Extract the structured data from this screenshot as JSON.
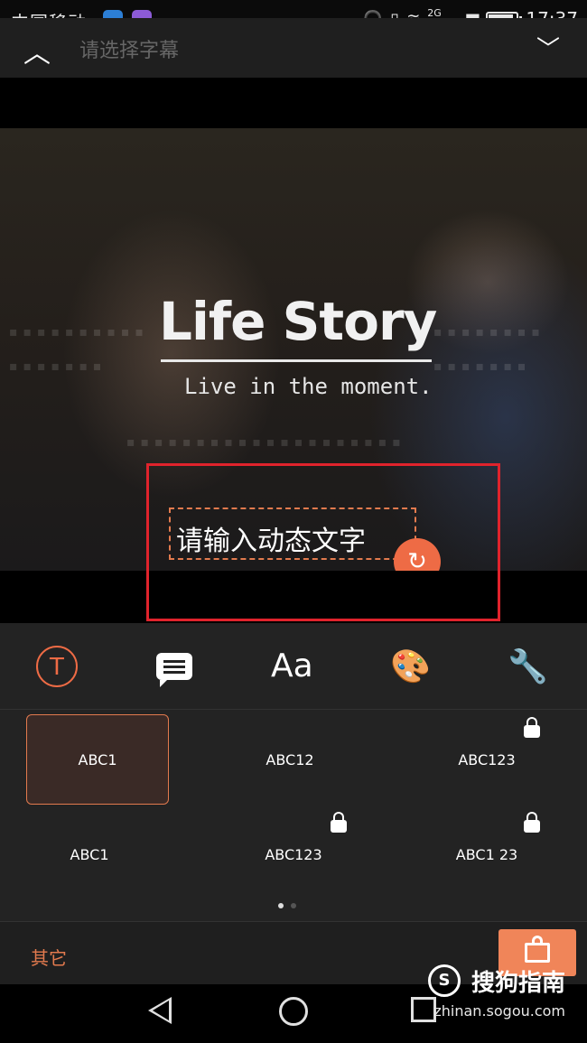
{
  "status_bar": {
    "carrier": "中国移动",
    "network": "2G",
    "time": "17:37",
    "battery_level": 0.9
  },
  "top_bar": {
    "title": "请选择字幕",
    "collapse_icon": "chevron-up-icon",
    "expand_icon": "chevron-down-icon"
  },
  "preview": {
    "headline": "Life Story",
    "subline": "Live in the moment.",
    "text_placeholder": "请输入动态文字",
    "rotate_icon": "rotate-icon"
  },
  "toolbar": {
    "tools": [
      "text-style-icon",
      "speech-bubble-icon",
      "font-icon",
      "palette-icon",
      "wrench-icon"
    ],
    "font_label": "Aa",
    "text_glyph": "T"
  },
  "styles": {
    "items": [
      {
        "label": "ABC1",
        "selected": true,
        "locked": false
      },
      {
        "label": "ABC12",
        "selected": false,
        "locked": false
      },
      {
        "label": "ABC123",
        "selected": false,
        "locked": true
      },
      {
        "label": "ABC1",
        "selected": false,
        "locked": false
      },
      {
        "label": "ABC123",
        "selected": false,
        "locked": true
      },
      {
        "label": "ABC1 23",
        "selected": false,
        "locked": true
      }
    ],
    "page": 1,
    "page_count": 2
  },
  "bottom_bar": {
    "other_label": "其它",
    "shop_icon": "shopping-bag-icon"
  },
  "watermark": {
    "brand": "搜狗指南",
    "logo_letter": "S",
    "url": "zhinan.sogou.com"
  },
  "colors": {
    "accent": "#ee6b45",
    "highlight_box": "#e0232c",
    "panel": "#232323"
  }
}
